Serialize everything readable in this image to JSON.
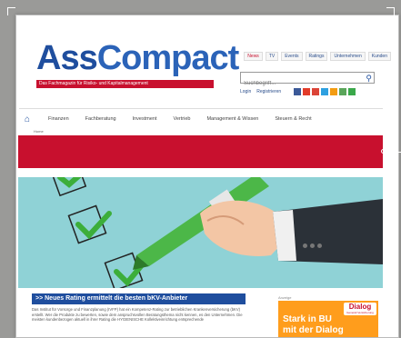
{
  "logo": {
    "part1": "Ass",
    "part2": "Compact"
  },
  "tagline": "Das Fachmagazin für Risiko- und Kapitalmanagement",
  "toplinks": [
    "News",
    "TV",
    "Events",
    "Ratings",
    "Unternehmen",
    "Kunden"
  ],
  "search": {
    "placeholder": "Suchbegriff..."
  },
  "account": {
    "login": "Login",
    "register": "Registrieren"
  },
  "nav": [
    "Finanzen",
    "Fachberatung",
    "Investment",
    "Vertrieb",
    "Management & Wissen",
    "Steuern & Recht"
  ],
  "breadcrumb": "Home",
  "article": {
    "headline": ">> Neues Rating ermittelt die besten bKV-Anbieter",
    "text": "Das Institut für Vorsorge und Finanzplanung (IVFP) hat ein Kompetenz-Rating zur betrieblichen Krankenversicherung (bKV) erstellt. Wer die Produkte zu bewerten, sowie dem anspruchsvollen Beratungsthema nicht kennen, es den Unternehmen. Die meisten kundenbezogen aktuell in ihrer Rating die HYGIENISCHE Kollektiveinrichtung entsprechende"
  },
  "ad": {
    "label": "Anzeige",
    "line1": "Stark in BU",
    "line2": "mit der Dialog",
    "brand": "Dialog",
    "brand_sub": "Generali Versicherung"
  },
  "colors": {
    "brand_blue": "#1f4e9e",
    "brand_red": "#c8102e",
    "hero_bg": "#8fd2d6",
    "ad_orange": "#ff9d1c"
  }
}
